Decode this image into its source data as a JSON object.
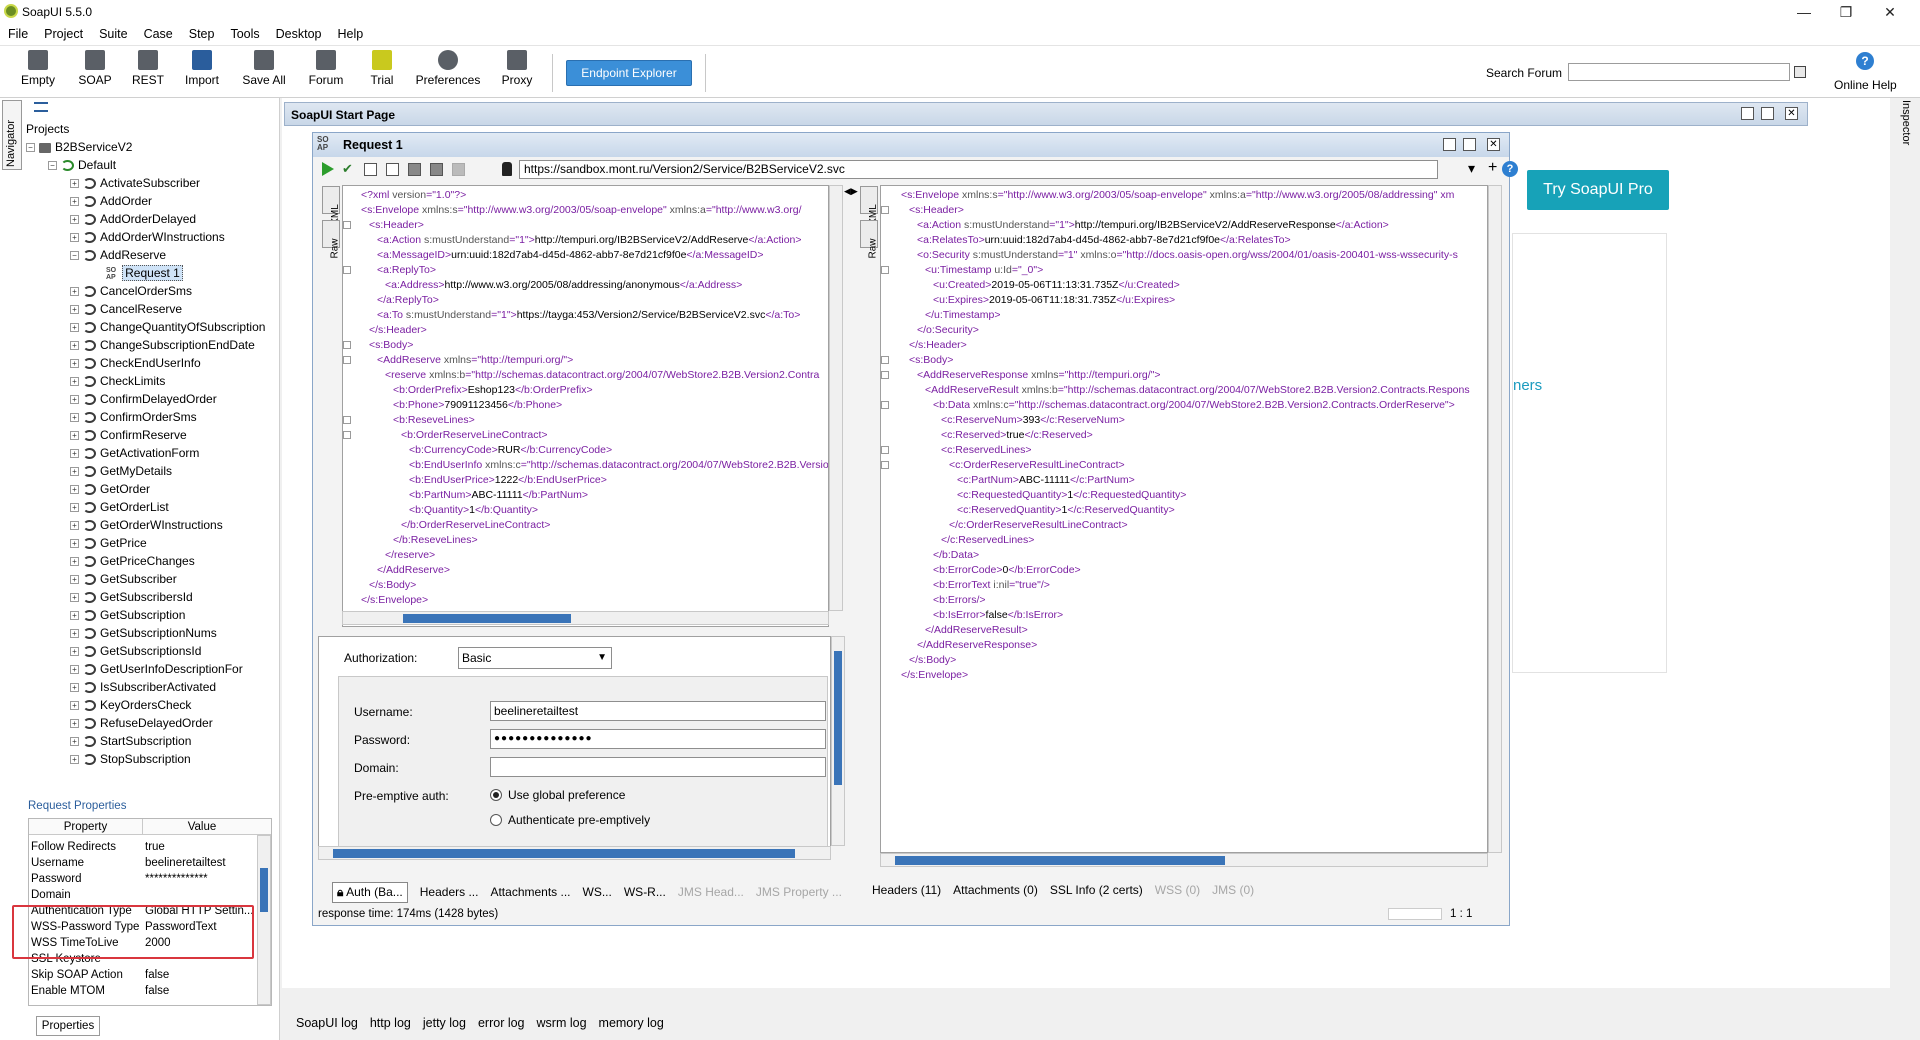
{
  "window": {
    "title": "SoapUI 5.5.0"
  },
  "menu": [
    "File",
    "Project",
    "Suite",
    "Case",
    "Step",
    "Tools",
    "Desktop",
    "Help"
  ],
  "toolbar": {
    "buttons": [
      "Empty",
      "SOAP",
      "REST",
      "Import",
      "Save All",
      "Forum",
      "Trial",
      "Preferences",
      "Proxy"
    ],
    "endpoint_explorer": "Endpoint Explorer",
    "search_label": "Search Forum",
    "online_help": "Online Help"
  },
  "navigator": {
    "tab_label": "Navigator",
    "projects_label": "Projects",
    "project": "B2BServiceV2",
    "interface": "Default",
    "operations": [
      "ActivateSubscriber",
      "AddOrder",
      "AddOrderDelayed",
      "AddOrderWInstructions",
      "AddReserve",
      "CancelOrderSms",
      "CancelReserve",
      "ChangeQuantityOfSubscription",
      "ChangeSubscriptionEndDate",
      "CheckEndUserInfo",
      "CheckLimits",
      "ConfirmDelayedOrder",
      "ConfirmOrderSms",
      "ConfirmReserve",
      "GetActivationForm",
      "GetMyDetails",
      "GetOrder",
      "GetOrderList",
      "GetOrderWInstructions",
      "GetPrice",
      "GetPriceChanges",
      "GetSubscriber",
      "GetSubscribersId",
      "GetSubscription",
      "GetSubscriptionNums",
      "GetSubscriptionsId",
      "GetUserInfoDescriptionFor",
      "IsSubscriberActivated",
      "KeyOrdersCheck",
      "RefuseDelayedOrder",
      "StartSubscription",
      "StopSubscription"
    ],
    "selected_request": "Request 1"
  },
  "request_properties": {
    "title": "Request Properties",
    "col_property": "Property",
    "col_value": "Value",
    "rows": [
      {
        "k": "Follow Redirects",
        "v": "true"
      },
      {
        "k": "Username",
        "v": "beelineretailtest"
      },
      {
        "k": "Password",
        "v": "**************"
      },
      {
        "k": "Domain",
        "v": ""
      },
      {
        "k": "Authentication Type",
        "v": "Global HTTP Settin..."
      },
      {
        "k": "WSS-Password Type",
        "v": "PasswordText"
      },
      {
        "k": "WSS TimeToLive",
        "v": "2000"
      },
      {
        "k": "SSL Keystore",
        "v": ""
      },
      {
        "k": "Skip SOAP Action",
        "v": "false"
      },
      {
        "k": "Enable MTOM",
        "v": "false"
      }
    ],
    "properties_button": "Properties"
  },
  "start_page": {
    "title": "SoapUI Start Page",
    "try_pro": "Try SoapUI Pro",
    "partial_text": "ners"
  },
  "request": {
    "title": "Request 1",
    "url": "https://sandbox.mont.ru/Version2/Service/B2BServiceV2.svc",
    "tab_xml": "XML",
    "tab_raw": "Raw",
    "request_xml": [
      {
        "i": 0,
        "t": "<?xml version=\"1.0\"?>"
      },
      {
        "i": 0,
        "t": "<s:Envelope xmlns:s=\"http://www.w3.org/2003/05/soap-envelope\" xmlns:a=\"http://www.w3.org/"
      },
      {
        "i": 1,
        "t": "<s:Header>"
      },
      {
        "i": 2,
        "t": "<a:Action s:mustUnderstand=\"1\">http://tempuri.org/IB2BServiceV2/AddReserve</a:Action>"
      },
      {
        "i": 2,
        "t": "<a:MessageID>urn:uuid:182d7ab4-d45d-4862-abb7-8e7d21cf9f0e</a:MessageID>"
      },
      {
        "i": 2,
        "t": "<a:ReplyTo>"
      },
      {
        "i": 3,
        "t": "<a:Address>http://www.w3.org/2005/08/addressing/anonymous</a:Address>"
      },
      {
        "i": 2,
        "t": "</a:ReplyTo>"
      },
      {
        "i": 2,
        "t": "<a:To s:mustUnderstand=\"1\">https://tayga:453/Version2/Service/B2BServiceV2.svc</a:To>"
      },
      {
        "i": 1,
        "t": "</s:Header>"
      },
      {
        "i": 1,
        "t": "<s:Body>"
      },
      {
        "i": 2,
        "t": "<AddReserve xmlns=\"http://tempuri.org/\">"
      },
      {
        "i": 3,
        "t": "<reserve xmlns:b=\"http://schemas.datacontract.org/2004/07/WebStore2.B2B.Version2.Contra"
      },
      {
        "i": 4,
        "t": "<b:OrderPrefix>Eshop123</b:OrderPrefix>"
      },
      {
        "i": 4,
        "t": "<b:Phone>79091123456</b:Phone>"
      },
      {
        "i": 4,
        "t": "<b:ReseveLines>"
      },
      {
        "i": 5,
        "t": "<b:OrderReserveLineContract>"
      },
      {
        "i": 6,
        "t": "<b:CurrencyCode>RUR</b:CurrencyCode>"
      },
      {
        "i": 6,
        "t": "<b:EndUserInfo xmlns:c=\"http://schemas.datacontract.org/2004/07/WebStore2.B2B.Versio"
      },
      {
        "i": 6,
        "t": "<b:EndUserPrice>1222</b:EndUserPrice>"
      },
      {
        "i": 6,
        "t": "<b:PartNum>ABC-11111</b:PartNum>"
      },
      {
        "i": 6,
        "t": "<b:Quantity>1</b:Quantity>"
      },
      {
        "i": 5,
        "t": "</b:OrderReserveLineContract>"
      },
      {
        "i": 4,
        "t": "</b:ReseveLines>"
      },
      {
        "i": 3,
        "t": "</reserve>"
      },
      {
        "i": 2,
        "t": "</AddReserve>"
      },
      {
        "i": 1,
        "t": "</s:Body>"
      },
      {
        "i": 0,
        "t": "</s:Envelope>"
      }
    ],
    "response_xml": [
      {
        "i": 0,
        "t": "<s:Envelope xmlns:s=\"http://www.w3.org/2003/05/soap-envelope\" xmlns:a=\"http://www.w3.org/2005/08/addressing\" xm"
      },
      {
        "i": 1,
        "t": "<s:Header>"
      },
      {
        "i": 2,
        "t": "<a:Action s:mustUnderstand=\"1\">http://tempuri.org/IB2BServiceV2/AddReserveResponse</a:Action>"
      },
      {
        "i": 2,
        "t": "<a:RelatesTo>urn:uuid:182d7ab4-d45d-4862-abb7-8e7d21cf9f0e</a:RelatesTo>"
      },
      {
        "i": 2,
        "t": "<o:Security s:mustUnderstand=\"1\" xmlns:o=\"http://docs.oasis-open.org/wss/2004/01/oasis-200401-wss-wssecurity-s"
      },
      {
        "i": 3,
        "t": "<u:Timestamp u:Id=\"_0\">"
      },
      {
        "i": 4,
        "t": "<u:Created>2019-05-06T11:13:31.735Z</u:Created>"
      },
      {
        "i": 4,
        "t": "<u:Expires>2019-05-06T11:18:31.735Z</u:Expires>"
      },
      {
        "i": 3,
        "t": "</u:Timestamp>"
      },
      {
        "i": 2,
        "t": "</o:Security>"
      },
      {
        "i": 1,
        "t": "</s:Header>"
      },
      {
        "i": 1,
        "t": "<s:Body>"
      },
      {
        "i": 2,
        "t": "<AddReserveResponse xmlns=\"http://tempuri.org/\">"
      },
      {
        "i": 3,
        "t": "<AddReserveResult xmlns:b=\"http://schemas.datacontract.org/2004/07/WebStore2.B2B.Version2.Contracts.Respons"
      },
      {
        "i": 4,
        "t": "<b:Data xmlns:c=\"http://schemas.datacontract.org/2004/07/WebStore2.B2B.Version2.Contracts.OrderReserve\">"
      },
      {
        "i": 5,
        "t": "<c:ReserveNum>393</c:ReserveNum>"
      },
      {
        "i": 5,
        "t": "<c:Reserved>true</c:Reserved>"
      },
      {
        "i": 5,
        "t": "<c:ReservedLines>"
      },
      {
        "i": 6,
        "t": "<c:OrderReserveResultLineContract>"
      },
      {
        "i": 7,
        "t": "<c:PartNum>ABC-11111</c:PartNum>"
      },
      {
        "i": 7,
        "t": "<c:RequestedQuantity>1</c:RequestedQuantity>"
      },
      {
        "i": 7,
        "t": "<c:ReservedQuantity>1</c:ReservedQuantity>"
      },
      {
        "i": 6,
        "t": "</c:OrderReserveResultLineContract>"
      },
      {
        "i": 5,
        "t": "</c:ReservedLines>"
      },
      {
        "i": 4,
        "t": "</b:Data>"
      },
      {
        "i": 4,
        "t": "<b:ErrorCode>0</b:ErrorCode>"
      },
      {
        "i": 4,
        "t": "<b:ErrorText i:nil=\"true\"/>"
      },
      {
        "i": 4,
        "t": "<b:Errors/>"
      },
      {
        "i": 4,
        "t": "<b:IsError>false</b:IsError>"
      },
      {
        "i": 3,
        "t": "</AddReserveResult>"
      },
      {
        "i": 2,
        "t": "</AddReserveResponse>"
      },
      {
        "i": 1,
        "t": "</s:Body>"
      },
      {
        "i": 0,
        "t": "</s:Envelope>"
      }
    ],
    "auth": {
      "authorization_label": "Authorization:",
      "authorization_value": "Basic",
      "username_label": "Username:",
      "username_value": "beelineretailtest",
      "password_label": "Password:",
      "password_value": "●●●●●●●●●●●●●●",
      "domain_label": "Domain:",
      "domain_value": "",
      "preemptive_label": "Pre-emptive auth:",
      "option_global": "Use global preference",
      "option_preemptive": "Authenticate pre-emptively"
    },
    "request_tabs": [
      "Auth (Ba...",
      "Headers ...",
      "Attachments ...",
      "WS...",
      "WS-R..."
    ],
    "request_tabs_dim": [
      "JMS Head...",
      "JMS Property ..."
    ],
    "response_tabs": [
      "Headers (11)",
      "Attachments (0)",
      "SSL Info (2 certs)"
    ],
    "response_tabs_dim": [
      "WSS (0)",
      "JMS (0)"
    ],
    "response_time": "response time: 174ms (1428 bytes)",
    "position": "1 : 1"
  },
  "log_tabs": [
    "SoapUI log",
    "http log",
    "jetty log",
    "error log",
    "wsrm log",
    "memory log"
  ],
  "inspector_label": "Inspector"
}
